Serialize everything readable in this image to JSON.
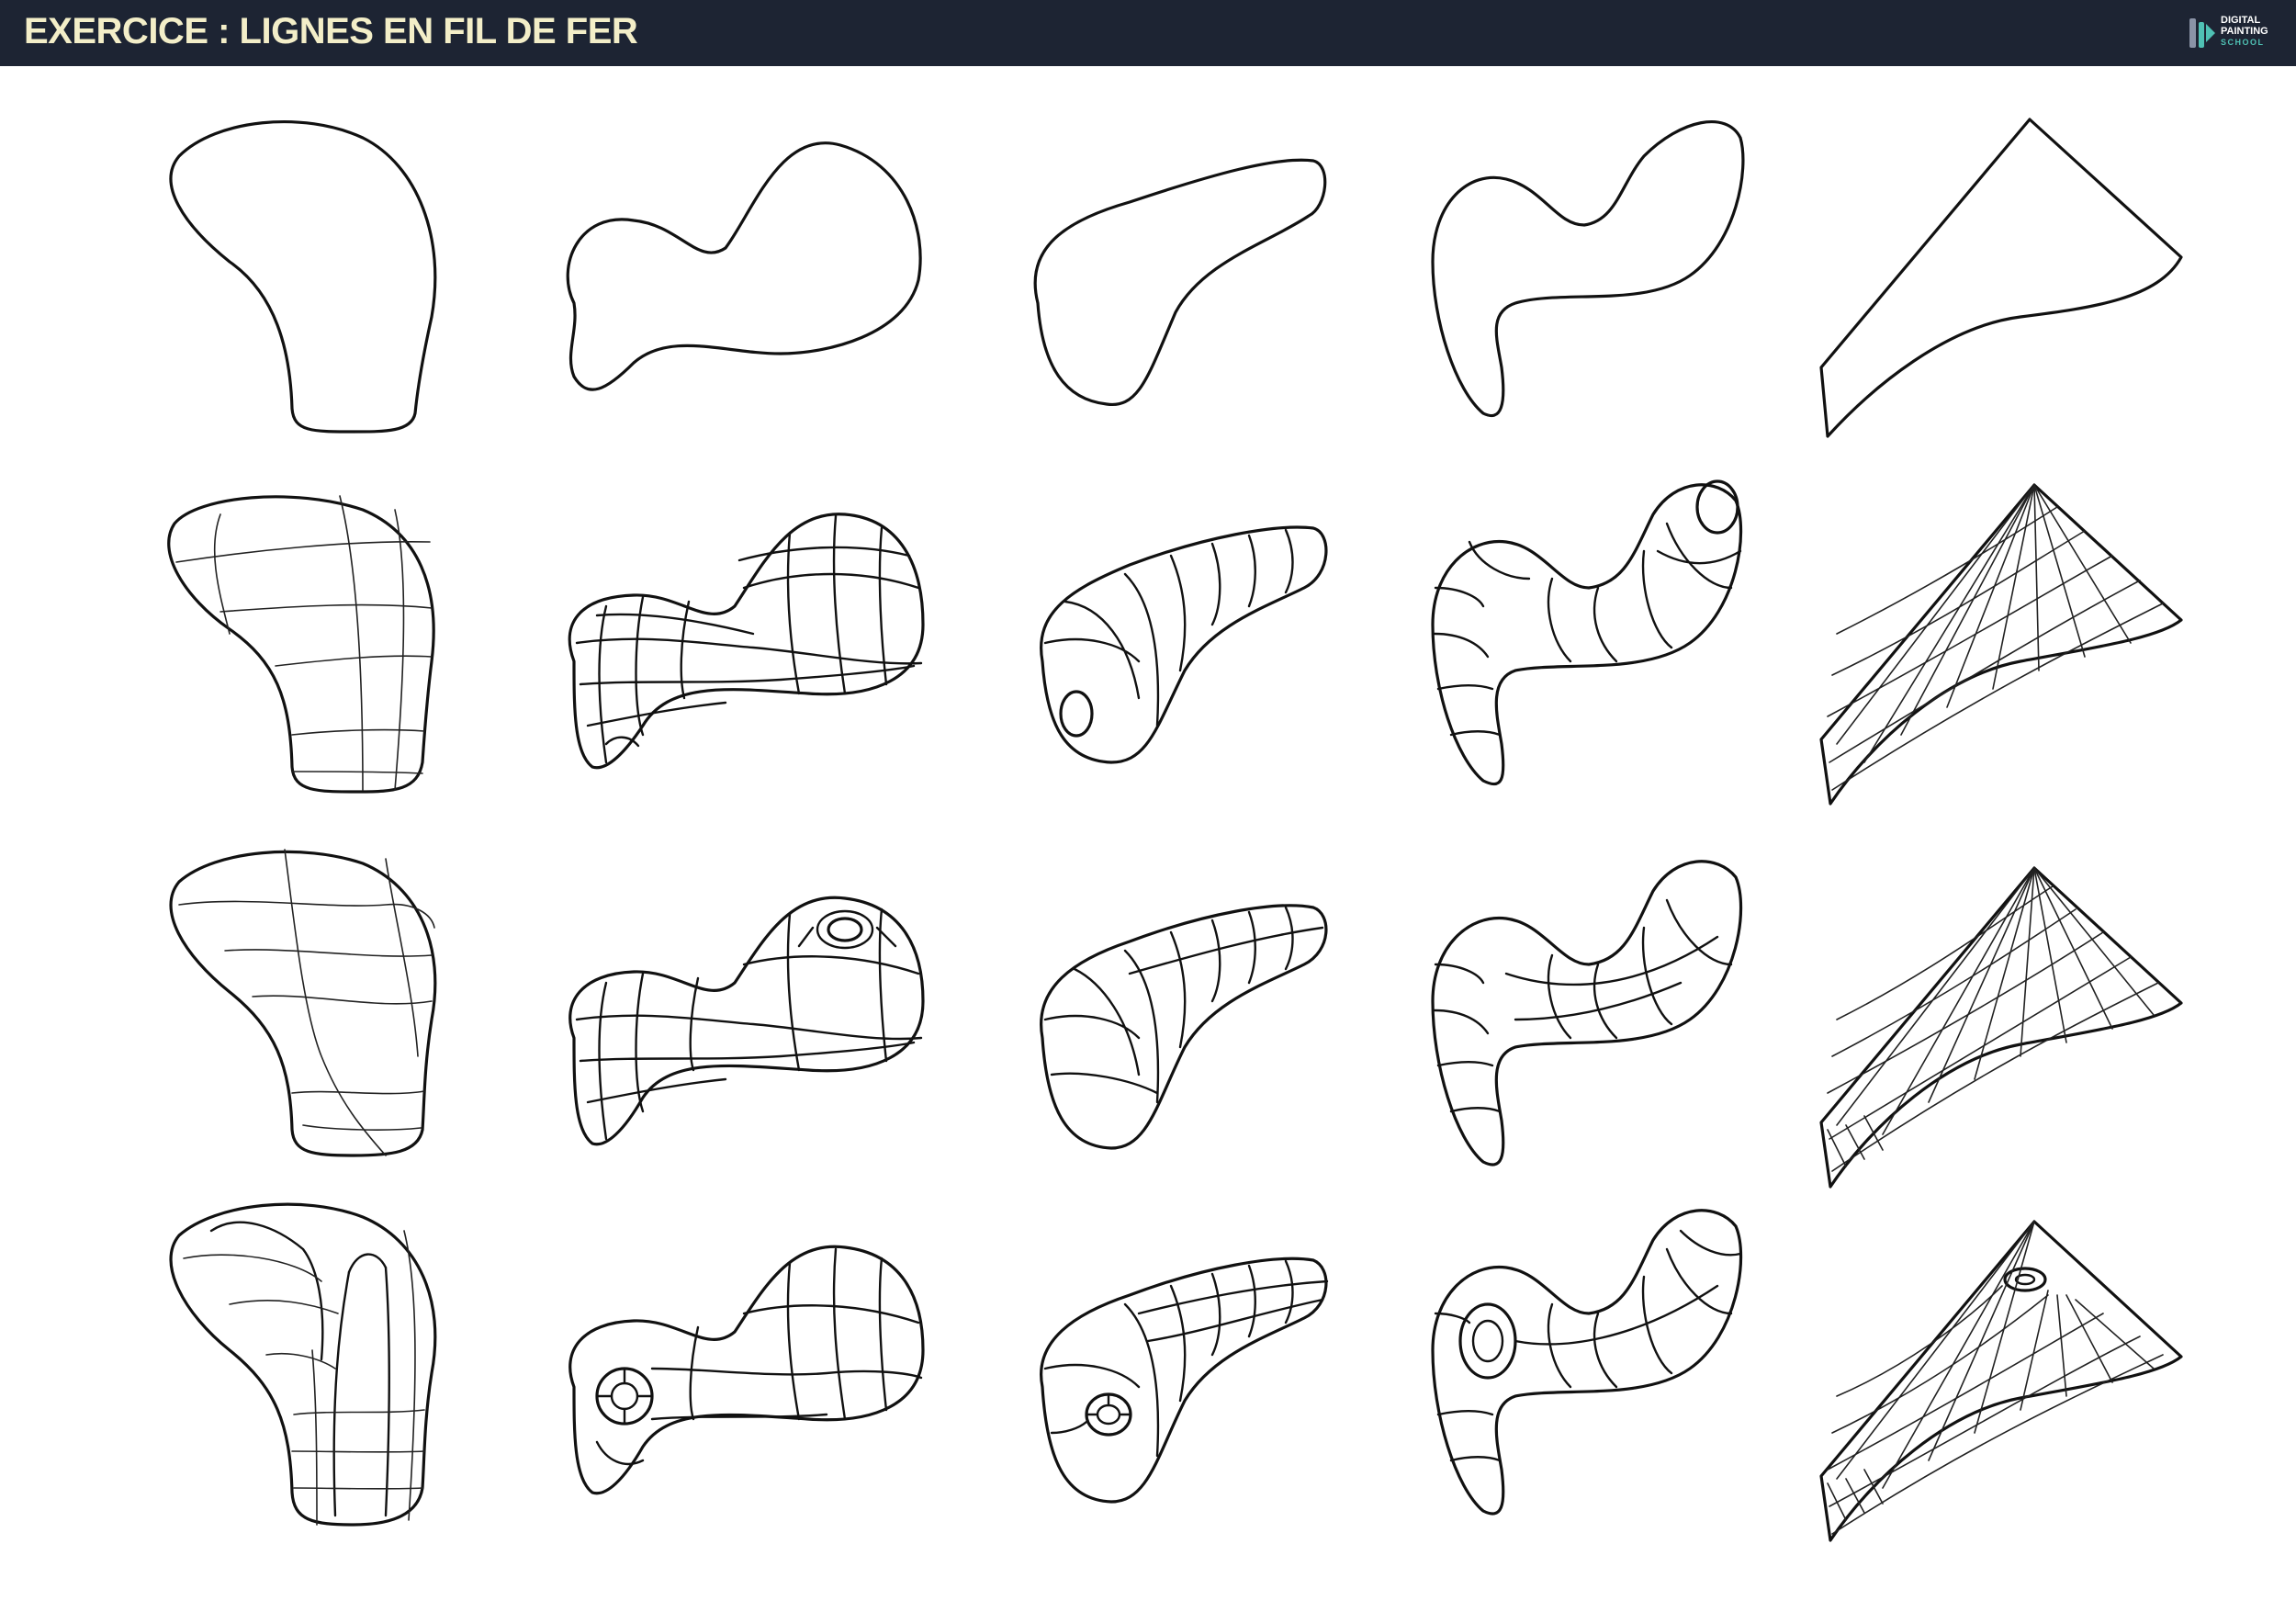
{
  "header": {
    "title": "EXERCICE : LIGNES EN FIL DE FER",
    "logo": {
      "line1": "DIGITAL",
      "line2": "PAINTING",
      "line3": "SCHOOL",
      "icon": "paintbrush-logo-icon"
    }
  },
  "colors": {
    "header_bg": "#1d2433",
    "title_text": "#f3eec8",
    "logo_accent": "#4fc1b4",
    "line": "#111111",
    "page_bg": "#ffffff"
  },
  "sheet": {
    "rows": 4,
    "columns": 5,
    "row_styles": [
      "outline",
      "wireframe",
      "wireframe",
      "wireframe-with-hole"
    ]
  }
}
